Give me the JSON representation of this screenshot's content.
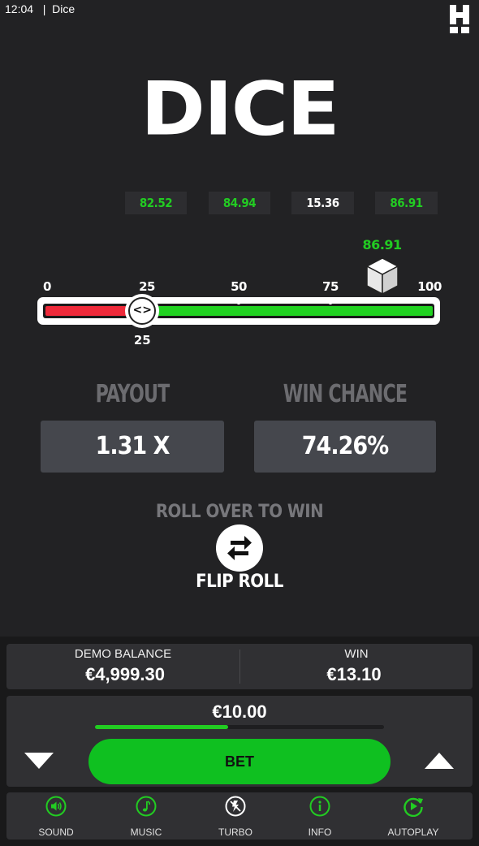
{
  "status_bar": {
    "time": "12:04",
    "separator": "|",
    "app": "Dice"
  },
  "title": "DICE",
  "history": [
    {
      "value": "82.52",
      "result": "win"
    },
    {
      "value": "84.94",
      "result": "win"
    },
    {
      "value": "15.36",
      "result": "lose"
    },
    {
      "value": "86.91",
      "result": "win"
    }
  ],
  "slider": {
    "ticks": [
      "0",
      "25",
      "50",
      "75",
      "100"
    ],
    "last_roll": "86.91",
    "last_roll_value": 86.91,
    "target_label": "25",
    "target_value": 25,
    "colors": {
      "lose": "#ee2a3a",
      "win": "#22d322"
    }
  },
  "stats": {
    "payout_label": "PAYOUT",
    "payout_value": "1.31 X",
    "chance_label": "WIN CHANCE",
    "chance_value": "74.26%"
  },
  "roll_mode": {
    "text": "ROLL OVER TO WIN",
    "flip_label": "FLIP ROLL"
  },
  "balance": {
    "demo_label": "DEMO BALANCE",
    "demo_value": "€4,999.30",
    "win_label": "WIN",
    "win_value": "€13.10"
  },
  "bet": {
    "amount": "€10.00",
    "level_fraction": 0.46,
    "button_label": "BET",
    "accent": "#0fc020"
  },
  "nav": [
    {
      "label": "SOUND",
      "icon": "speaker-icon",
      "active": true
    },
    {
      "label": "MUSIC",
      "icon": "music-note-icon",
      "active": true
    },
    {
      "label": "TURBO",
      "icon": "turbo-off-icon",
      "active": false
    },
    {
      "label": "INFO",
      "icon": "info-icon",
      "active": true
    },
    {
      "label": "AUTOPLAY",
      "icon": "autoplay-icon",
      "active": true
    }
  ]
}
